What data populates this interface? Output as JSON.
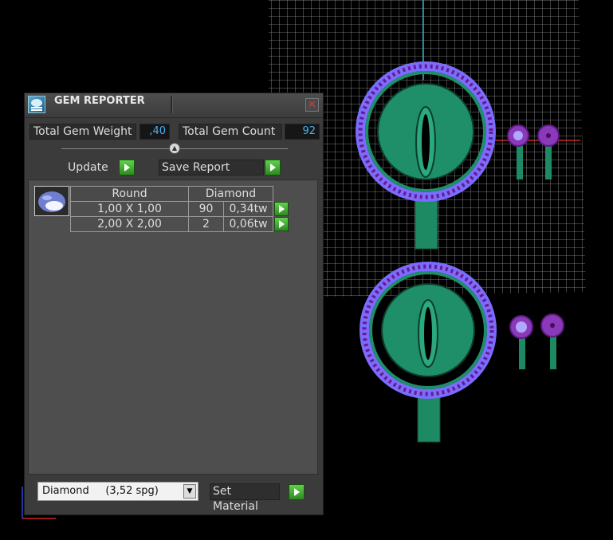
{
  "gem_reporter": {
    "title": "GEM REPORTER",
    "close_icon": "close-x-icon",
    "total_gem_weight_label": "Total Gem Weight",
    "total_gem_weight_value": ",40",
    "total_gem_count_label": "Total Gem Count",
    "total_gem_count_value": "92",
    "update_label": "Update",
    "save_report_label": "Save Report",
    "table": {
      "shape": "Round",
      "material": "Diamond",
      "rows": [
        {
          "size": "1,00 X 1,00",
          "count": "90",
          "weight": "0,34tw"
        },
        {
          "size": "2,00 X 2,00",
          "count": "2",
          "weight": "0,06tw"
        }
      ]
    },
    "material_select_value": "Diamond     (3,52 spg)",
    "set_material_label": "Set Material"
  },
  "colors": {
    "accent_play": "#3fb82f",
    "value_text": "#46b4f0",
    "setting_green": "#1f8f6a",
    "gem_purple": "#7a6cff"
  }
}
